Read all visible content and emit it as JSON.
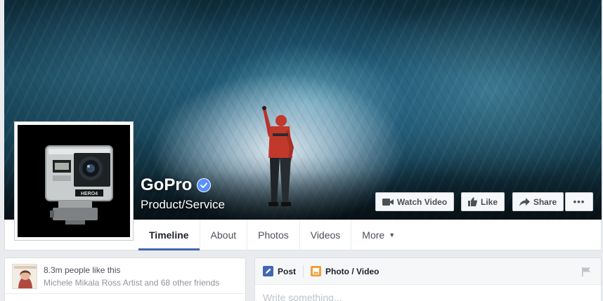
{
  "page": {
    "name": "GoPro",
    "category": "Product/Service",
    "verified_icon": "verified-badge-icon",
    "brand_blue": "#4267b2"
  },
  "profile": {
    "camera_model": "HERO4"
  },
  "actions": {
    "watch_video": "Watch Video",
    "like": "Like",
    "share": "Share",
    "more": "•••"
  },
  "tabs": [
    {
      "label": "Timeline",
      "active": true
    },
    {
      "label": "About"
    },
    {
      "label": "Photos"
    },
    {
      "label": "Videos"
    },
    {
      "label": "More"
    }
  ],
  "likes": {
    "count_text": "8.3m people like this",
    "friends_text": "Michele Mikala Ross Artist and 68 other friends"
  },
  "composer": {
    "post_label": "Post",
    "photo_video_label": "Photo / Video",
    "placeholder": "Write something..."
  }
}
